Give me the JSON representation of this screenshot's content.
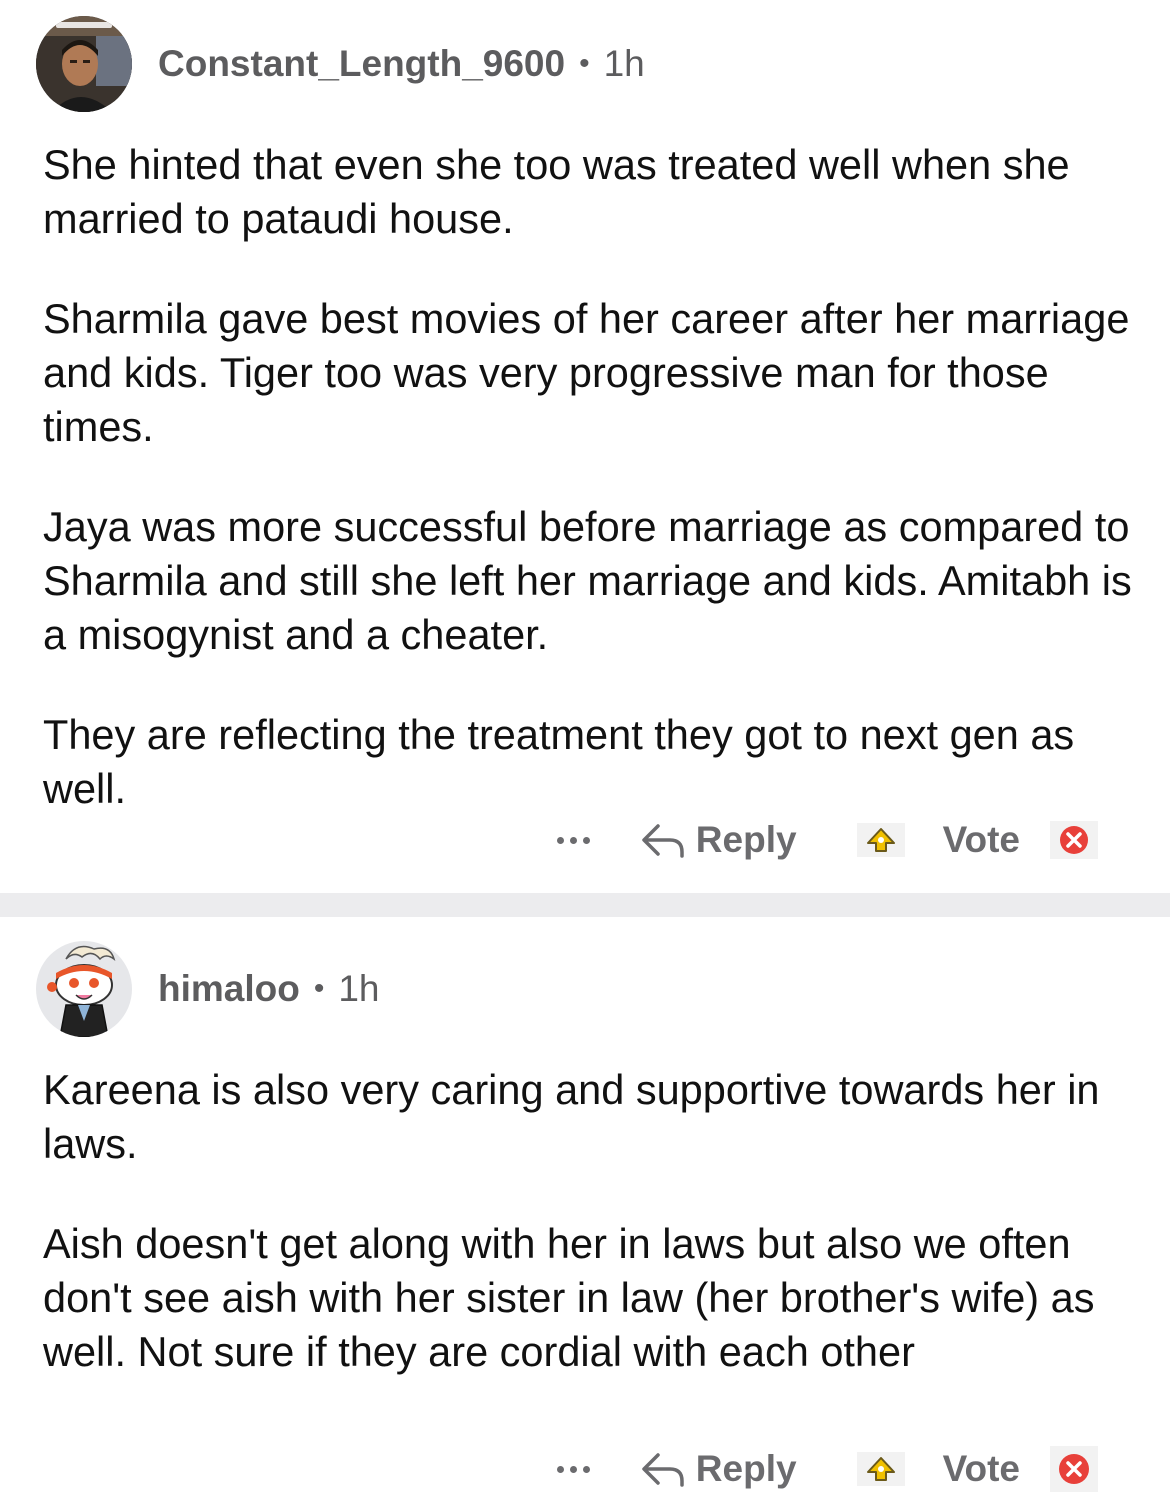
{
  "comments": [
    {
      "username": "Constant_Length_9600",
      "separator": "•",
      "age": "1h",
      "paragraphs": [
        "She hinted that even she too was treated well when she married to pataudi house.",
        "Sharmila gave best movies of her career after her marriage and kids. Tiger too was very progressive man for those times.",
        "Jaya was more successful before marriage as compared to Sharmila and still she left her marriage and kids. Amitabh is a misogynist and a cheater.",
        "They are reflecting the treatment they got to next gen as well."
      ],
      "actions": {
        "more_icon": "ellipsis-icon",
        "reply_icon": "reply-arrow-icon",
        "reply_label": "Reply",
        "upvote_icon": "upvote-icon",
        "vote_label": "Vote",
        "downvote_icon": "downvote-icon"
      }
    },
    {
      "username": "himaloo",
      "separator": "•",
      "age": "1h",
      "paragraphs": [
        "Kareena is also very caring and supportive towards her in laws.",
        "Aish doesn't get along with her in laws but also we often don't see aish with her sister in law (her brother's wife) as well. Not sure if they are cordial with each other"
      ],
      "actions": {
        "more_icon": "ellipsis-icon",
        "reply_icon": "reply-arrow-icon",
        "reply_label": "Reply",
        "upvote_icon": "upvote-icon",
        "vote_label": "Vote",
        "downvote_icon": "downvote-icon"
      }
    }
  ],
  "colors": {
    "divider": "#ececee",
    "meta_text": "#5c5c5e",
    "body_text": "#111111",
    "action_text": "#6b6b6e",
    "upvote_accent": "#f0c000",
    "downvote_accent": "#e8403a"
  }
}
